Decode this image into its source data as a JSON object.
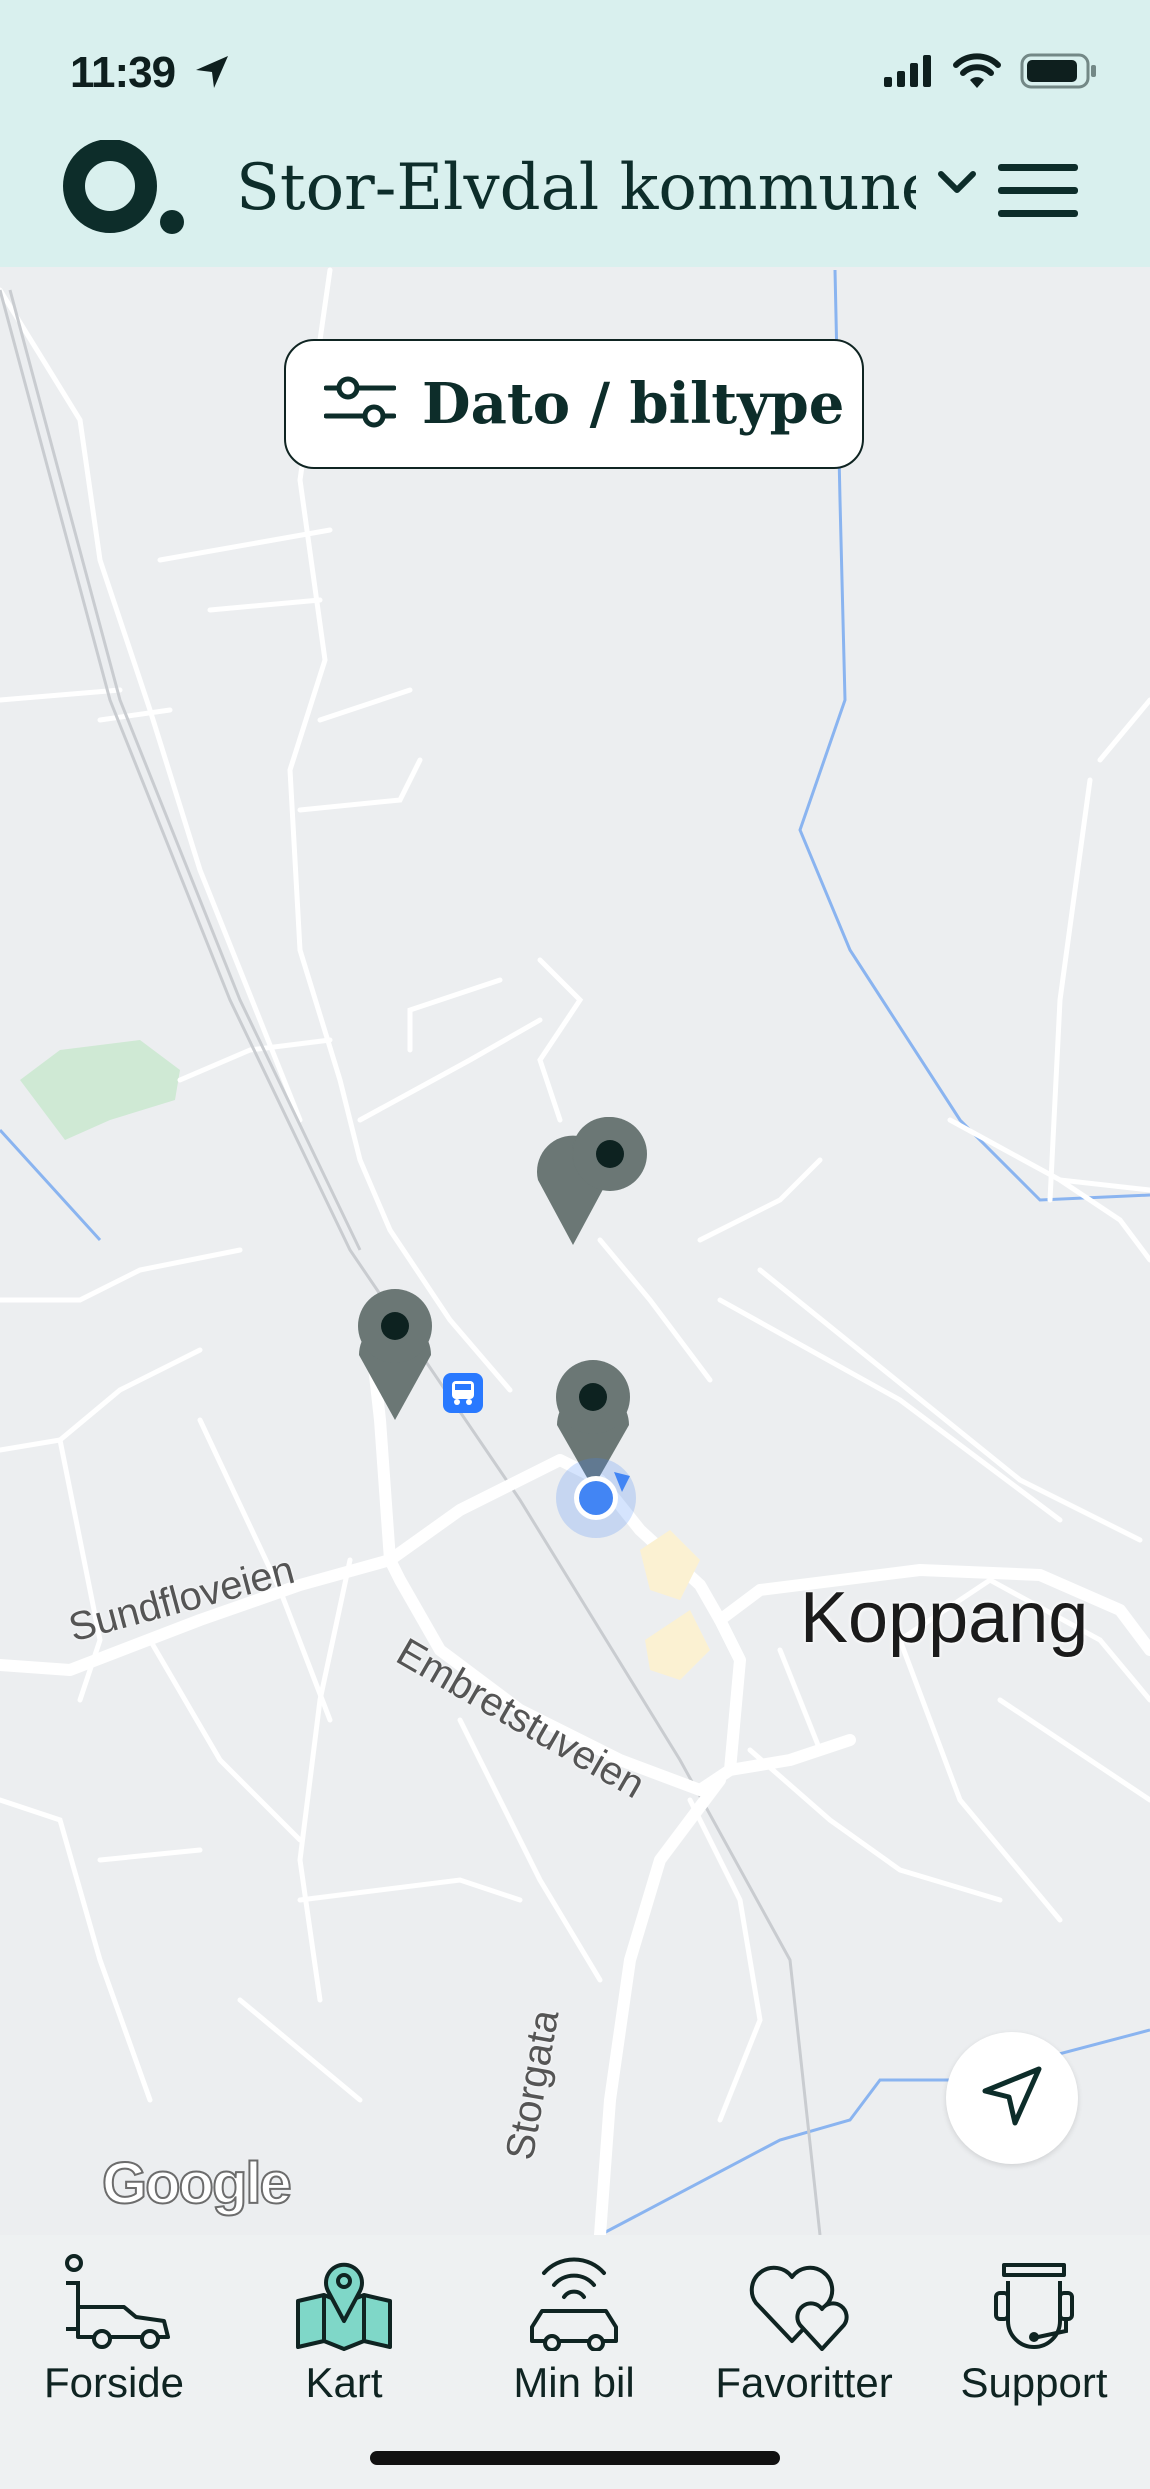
{
  "status_bar": {
    "time": "11:39"
  },
  "header": {
    "municipality": "Stor-Elvdal kommune"
  },
  "filter": {
    "label": "Dato / biltype"
  },
  "map": {
    "place_label": "Koppang",
    "street_labels": [
      "Sundfloveien",
      "Embretstuveien",
      "Storgata"
    ],
    "attribution": "Google",
    "pin_count": 3
  },
  "nav": {
    "items": [
      {
        "label": "Forside",
        "icon": "home-car-icon"
      },
      {
        "label": "Kart",
        "icon": "map-icon",
        "active": true
      },
      {
        "label": "Min bil",
        "icon": "connected-car-icon"
      },
      {
        "label": "Favoritter",
        "icon": "hearts-icon"
      },
      {
        "label": "Support",
        "icon": "support-headset-icon"
      }
    ]
  },
  "colors": {
    "header_bg": "#d9f0ee",
    "text_dark": "#0d2d2a",
    "pin": "#6b7775",
    "user_location": "#4285f4",
    "accent_teal": "#7fd7c8"
  }
}
